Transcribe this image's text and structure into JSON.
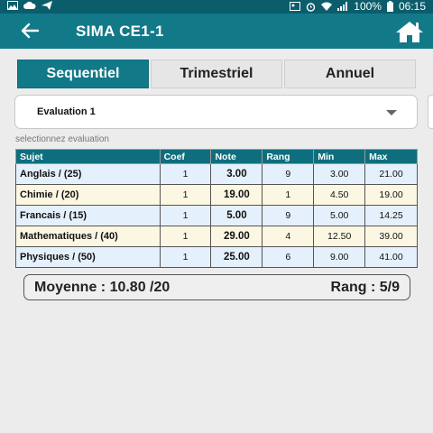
{
  "status_bar": {
    "battery": "100%",
    "time": "06:15"
  },
  "app_bar": {
    "title": "SIMA CE1-1"
  },
  "tabs": [
    {
      "label": "Sequentiel",
      "active": true
    },
    {
      "label": "Trimestriel",
      "active": false
    },
    {
      "label": "Annuel",
      "active": false
    }
  ],
  "evaluation_select": {
    "value": "Evaluation 1",
    "hint": "selectionnez evaluation"
  },
  "table": {
    "headers": [
      "Sujet",
      "Coef",
      "Note",
      "Rang",
      "Min",
      "Max"
    ],
    "rows": [
      {
        "sujet": "Anglais / (25)",
        "coef": "1",
        "note": "3.00",
        "rang": "9",
        "min": "3.00",
        "max": "21.00"
      },
      {
        "sujet": "Chimie / (20)",
        "coef": "1",
        "note": "19.00",
        "rang": "1",
        "min": "4.50",
        "max": "19.00"
      },
      {
        "sujet": "Francais / (15)",
        "coef": "1",
        "note": "5.00",
        "rang": "9",
        "min": "5.00",
        "max": "14.25"
      },
      {
        "sujet": "Mathematiques / (40)",
        "coef": "1",
        "note": "29.00",
        "rang": "4",
        "min": "12.50",
        "max": "39.00"
      },
      {
        "sujet": "Physiques / (50)",
        "coef": "1",
        "note": "25.00",
        "rang": "6",
        "min": "9.00",
        "max": "41.00"
      }
    ]
  },
  "summary": {
    "moyenne": "Moyenne : 10.80 /20",
    "rang": "Rang : 5/9"
  },
  "colors": {
    "primary": "#127988",
    "status_bar": "#0b5d6b",
    "row_odd": "#e4f0fb",
    "row_even": "#fcf7e2"
  }
}
